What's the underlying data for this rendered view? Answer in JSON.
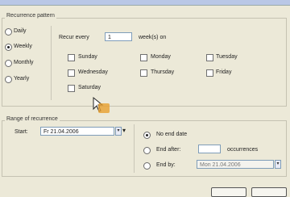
{
  "window": {
    "title": ""
  },
  "pattern": {
    "group_title": "Recurrence pattern",
    "options": [
      {
        "label": "Daily",
        "selected": false
      },
      {
        "label": "Weekly",
        "selected": true
      },
      {
        "label": "Monthly",
        "selected": false
      },
      {
        "label": "Yearly",
        "selected": false
      }
    ],
    "recur_every_label": "Recur every",
    "recur_every_value": "1",
    "weeks_on_label": "week(s) on",
    "days": [
      {
        "label": "Sunday",
        "checked": false
      },
      {
        "label": "Monday",
        "checked": false
      },
      {
        "label": "Tuesday",
        "checked": false
      },
      {
        "label": "Wednesday",
        "checked": false
      },
      {
        "label": "Thursday",
        "checked": false
      },
      {
        "label": "Friday",
        "checked": false
      },
      {
        "label": "Saturday",
        "checked": false
      }
    ]
  },
  "range": {
    "group_title": "Range of recurrence",
    "start_label": "Start:",
    "start_value": "Fr 21.04.2006",
    "no_end_label": "No end date",
    "no_end_selected": true,
    "end_after_label": "End after:",
    "occurrences_value": "",
    "occurrences_label": "occurrences",
    "end_by_label": "End by:",
    "end_by_value": "Mon 21.04.2006"
  },
  "colors": {
    "accent": "#b9c7e6",
    "background": "#ece9d8"
  }
}
